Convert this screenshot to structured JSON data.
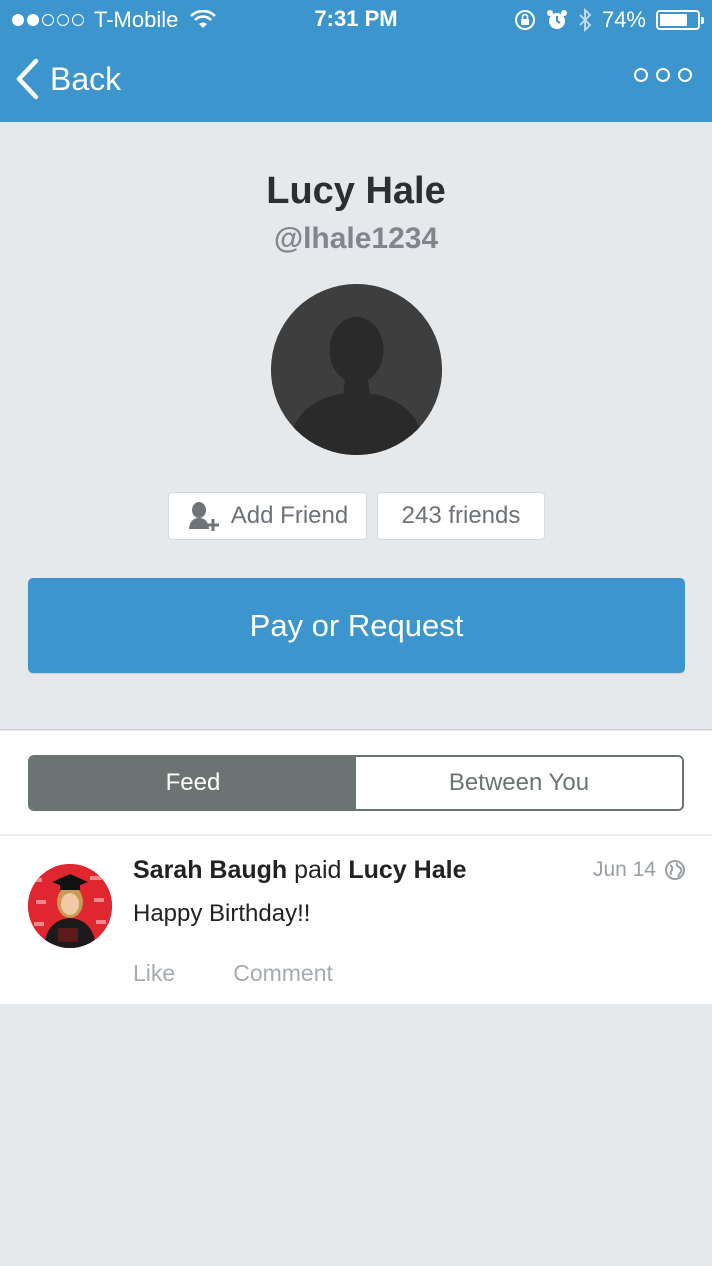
{
  "status_bar": {
    "carrier": "T-Mobile",
    "time": "7:31 PM",
    "battery_percent": "74%",
    "battery_level": 0.74,
    "signal_bars_filled": 2,
    "signal_bars_total": 5
  },
  "nav": {
    "back_label": "Back",
    "more_icon": "ellipsis-icon"
  },
  "profile": {
    "name": "Lucy Hale",
    "handle": "@lhale1234",
    "add_friend_label": "Add Friend",
    "friends_count_label": "243 friends",
    "pay_button_label": "Pay or Request"
  },
  "tabs": [
    {
      "label": "Feed",
      "active": true
    },
    {
      "label": "Between You",
      "active": false
    }
  ],
  "feed": [
    {
      "actor": "Sarah Baugh",
      "verb": "paid",
      "target": "Lucy Hale",
      "date": "Jun 14",
      "message": "Happy Birthday!!",
      "actions": [
        "Like",
        "Comment"
      ],
      "privacy_icon": "globe-icon"
    }
  ],
  "colors": {
    "brand_blue": "#3d95ce",
    "tab_active": "#6b7473",
    "background": "#e6e9ec"
  }
}
